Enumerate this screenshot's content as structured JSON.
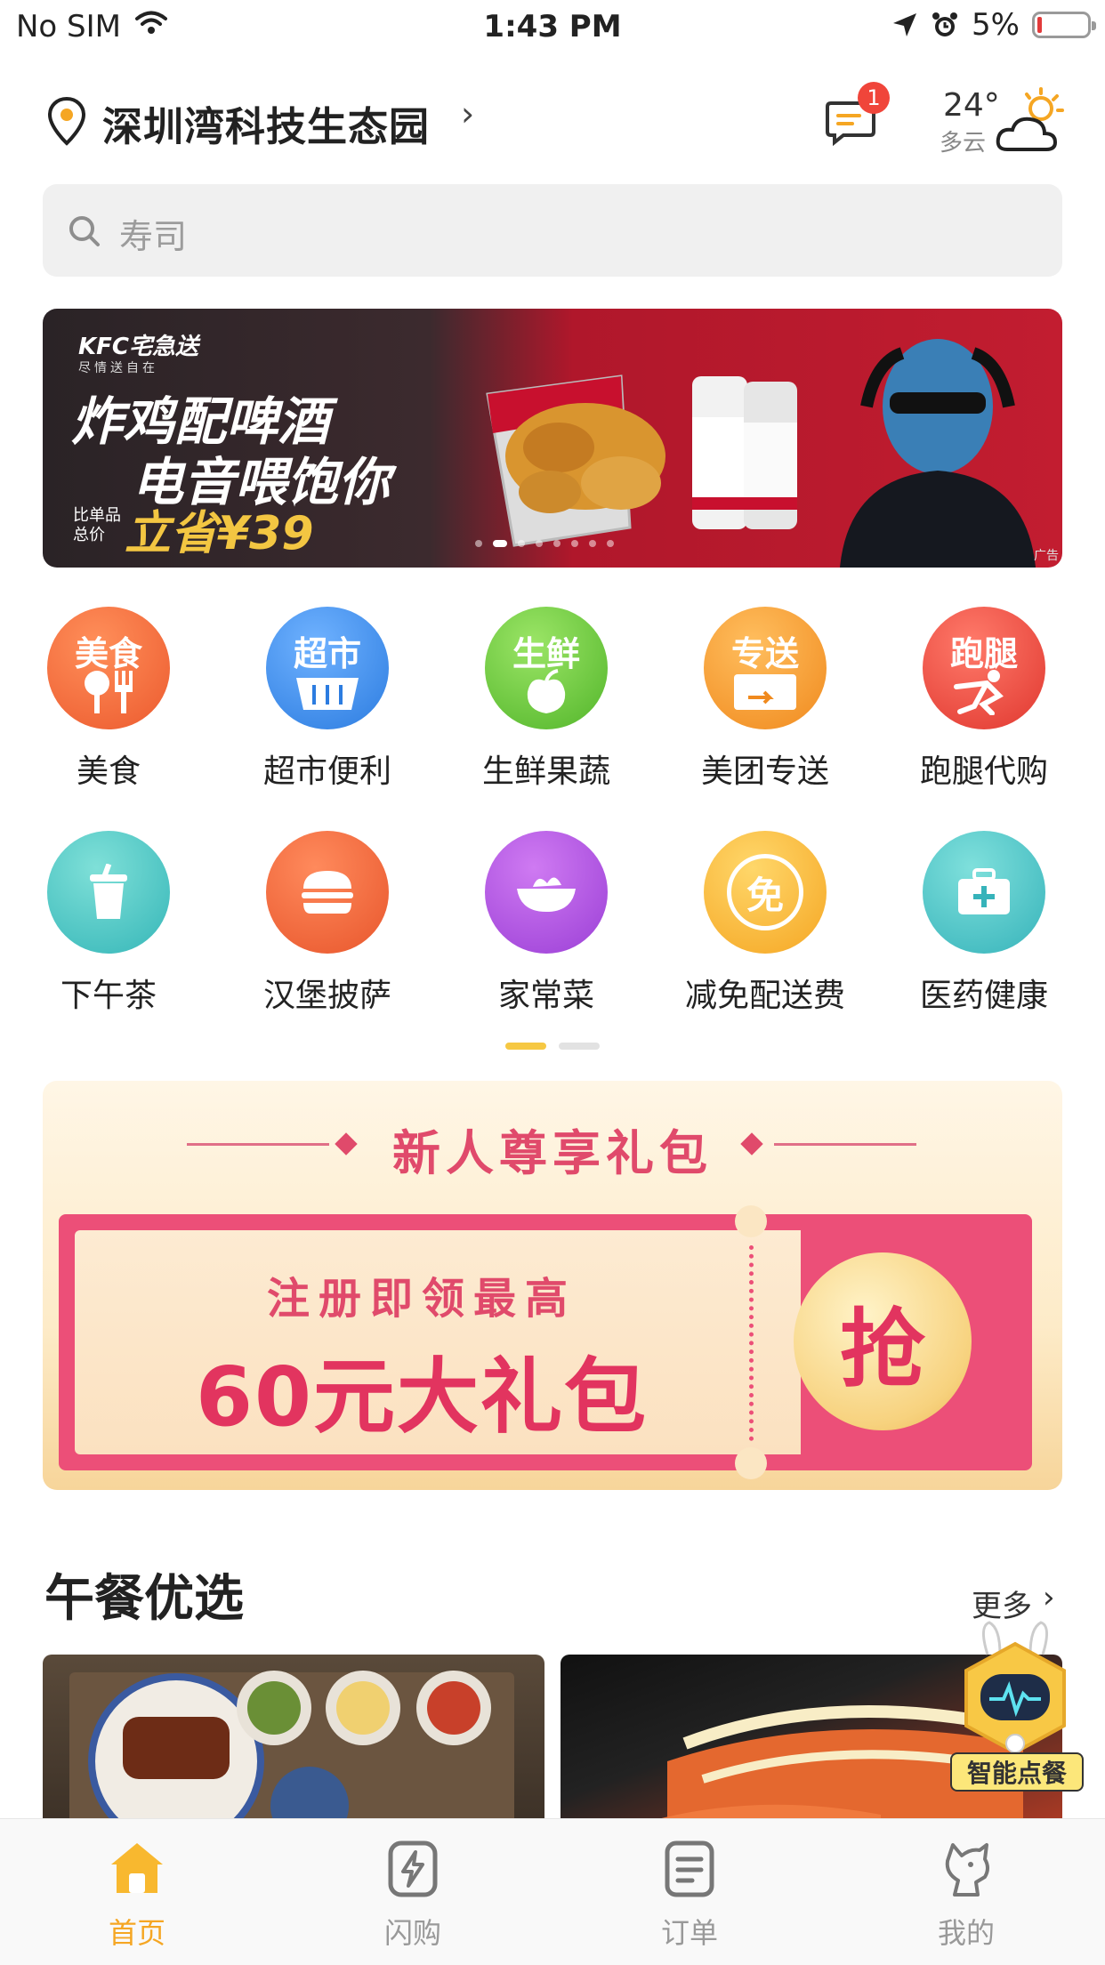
{
  "status_bar": {
    "carrier": "No SIM",
    "time": "1:43 PM",
    "battery": "5%"
  },
  "header": {
    "location": "深圳湾科技生态园",
    "message_badge": "1",
    "weather_temp": "24°",
    "weather_desc": "多云"
  },
  "search": {
    "placeholder": "寿司"
  },
  "banner": {
    "brand": "KFC宅急送",
    "brand_sub": "尽情送自在",
    "line1": "炸鸡配啤酒",
    "line2": "电音喂饱你",
    "price_note": "比单品总价",
    "price_value": "立省¥39",
    "ad_label": "广告"
  },
  "categories": [
    {
      "icon_text": "美食",
      "label": "美食",
      "icon": "food-icon",
      "color": "#f26d3c"
    },
    {
      "icon_text": "超市",
      "label": "超市便利",
      "icon": "supermarket-icon",
      "color": "#3f8ee9"
    },
    {
      "icon_text": "生鲜",
      "label": "生鲜果蔬",
      "icon": "fresh-produce-icon",
      "color": "#6ccb3f"
    },
    {
      "icon_text": "专送",
      "label": "美团专送",
      "icon": "delivery-icon",
      "color": "#f6a33a"
    },
    {
      "icon_text": "跑腿",
      "label": "跑腿代购",
      "icon": "errand-icon",
      "color": "#ec4a4a"
    },
    {
      "icon_text": "",
      "label": "下午茶",
      "icon": "drink-icon",
      "color": "#4cc6c4"
    },
    {
      "icon_text": "",
      "label": "汉堡披萨",
      "icon": "burger-icon",
      "color": "#f16a3f"
    },
    {
      "icon_text": "",
      "label": "家常菜",
      "icon": "dish-icon",
      "color": "#b14be0"
    },
    {
      "icon_text": "免",
      "label": "减免配送费",
      "icon": "free-delivery-icon",
      "color": "#f8bf3b"
    },
    {
      "icon_text": "",
      "label": "医药健康",
      "icon": "medicine-icon",
      "color": "#45c4c6"
    }
  ],
  "promo": {
    "title": "新人尊享礼包",
    "coupon_line1": "注册即领最高",
    "coupon_line2": "60元大礼包",
    "grab": "抢"
  },
  "section": {
    "title": "午餐优选",
    "more": "更多"
  },
  "robot": {
    "label": "智能点餐"
  },
  "tabs": [
    {
      "label": "首页",
      "icon": "home-icon",
      "active": true
    },
    {
      "label": "闪购",
      "icon": "flash-buy-icon",
      "active": false
    },
    {
      "label": "订单",
      "icon": "orders-icon",
      "active": false
    },
    {
      "label": "我的",
      "icon": "profile-icon",
      "active": false
    }
  ],
  "colors": {
    "accent": "#f5a623",
    "promo_pink": "#e04a6b",
    "badge_red": "#f0453a"
  }
}
